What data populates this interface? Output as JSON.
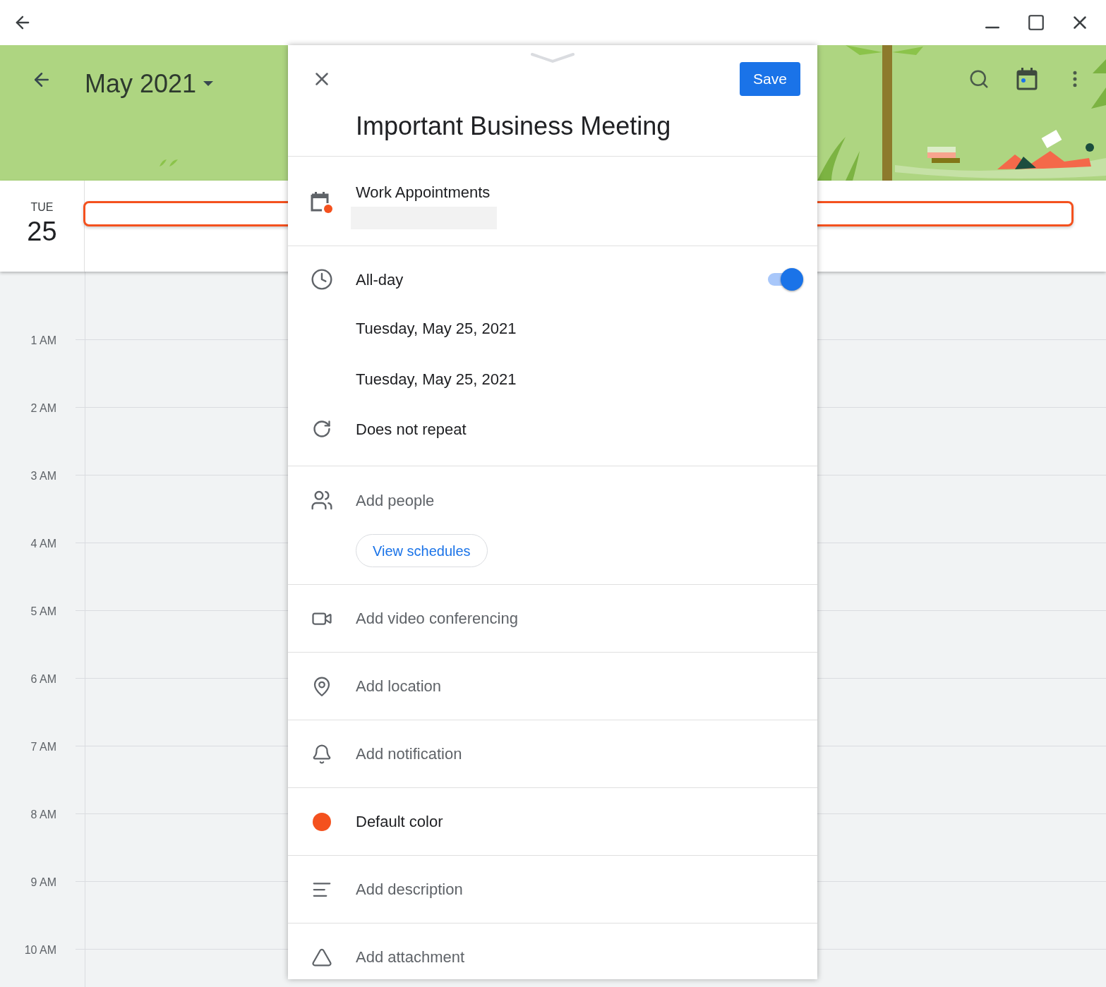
{
  "header": {
    "month_title": "May 2021"
  },
  "day": {
    "weekday": "TUE",
    "date": "25"
  },
  "hours": [
    "1 AM",
    "2 AM",
    "3 AM",
    "4 AM",
    "5 AM",
    "6 AM",
    "7 AM",
    "8 AM",
    "9 AM",
    "10 AM"
  ],
  "sheet": {
    "title": "Important Business Meeting",
    "save": "Save",
    "calendar": "Work Appointments",
    "all_day": {
      "label": "All-day",
      "on": true
    },
    "start_date": "Tuesday, May 25, 2021",
    "end_date": "Tuesday, May 25, 2021",
    "repeat": "Does not repeat",
    "people": {
      "placeholder": "Add people",
      "button": "View schedules"
    },
    "rows": [
      {
        "kind": "video",
        "text": "Add video conferencing"
      },
      {
        "kind": "location",
        "text": "Add location"
      },
      {
        "kind": "notification",
        "text": "Add notification"
      },
      {
        "kind": "color",
        "text": "Default color",
        "color": "#f4511e"
      },
      {
        "kind": "description",
        "text": "Add description"
      },
      {
        "kind": "attachment",
        "text": "Add attachment"
      }
    ]
  }
}
